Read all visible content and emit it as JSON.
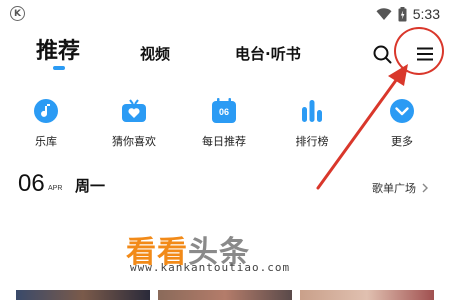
{
  "status_bar": {
    "time": "5:33",
    "badge": "K"
  },
  "top_nav": {
    "tabs": [
      {
        "label": "推荐",
        "active": true
      },
      {
        "label": "视频",
        "active": false
      },
      {
        "label": "电台·听书",
        "active": false
      }
    ]
  },
  "quick_entries": [
    {
      "label": "乐库",
      "icon": "music-note-icon"
    },
    {
      "label": "猜你喜欢",
      "icon": "radio-heart-icon"
    },
    {
      "label": "每日推荐",
      "icon": "calendar-icon",
      "badge": "06"
    },
    {
      "label": "排行榜",
      "icon": "ranking-bars-icon"
    },
    {
      "label": "更多",
      "icon": "more-chevron-icon"
    }
  ],
  "daily": {
    "day": "06",
    "month": "APR",
    "weekday": "周一",
    "link_label": "歌单广场"
  },
  "watermark": {
    "logo_orange": "看看",
    "logo_gray": "头条",
    "url": "www.kankantoutiao.com"
  },
  "colors": {
    "accent": "#2b9bf4",
    "annotation": "#d9372b",
    "watermark": "#f28a18"
  }
}
